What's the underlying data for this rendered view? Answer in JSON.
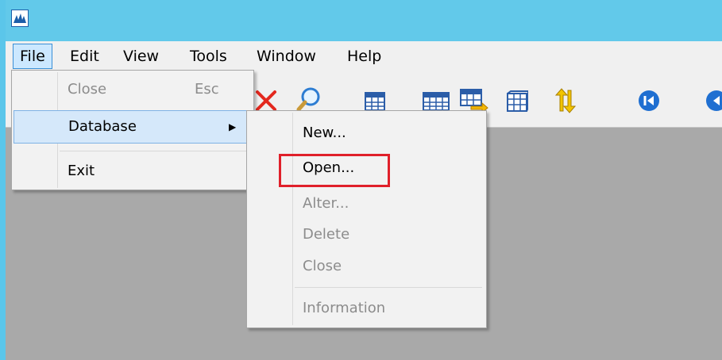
{
  "menubar": {
    "file": "File",
    "edit": "Edit",
    "view": "View",
    "tools": "Tools",
    "window": "Window",
    "help": "Help"
  },
  "file_menu": {
    "close": "Close",
    "close_shortcut": "Esc",
    "database": "Database",
    "exit": "Exit"
  },
  "database_menu": {
    "new": "New...",
    "open": "Open...",
    "alter": "Alter...",
    "delete": "Delete",
    "close": "Close",
    "information": "Information"
  },
  "toolbar_icons": [
    "delete-x-icon",
    "search-icon",
    "table-icon",
    "table-icon",
    "table-move-icon",
    "grid-icon",
    "swap-arrows-icon",
    "first-record-icon",
    "previous-record-icon"
  ],
  "colors": {
    "titlebar": "#62c9ea",
    "workspace": "#a9a9a9",
    "highlight_box": "#e0202a",
    "selected_item": "#d5e8fa"
  }
}
